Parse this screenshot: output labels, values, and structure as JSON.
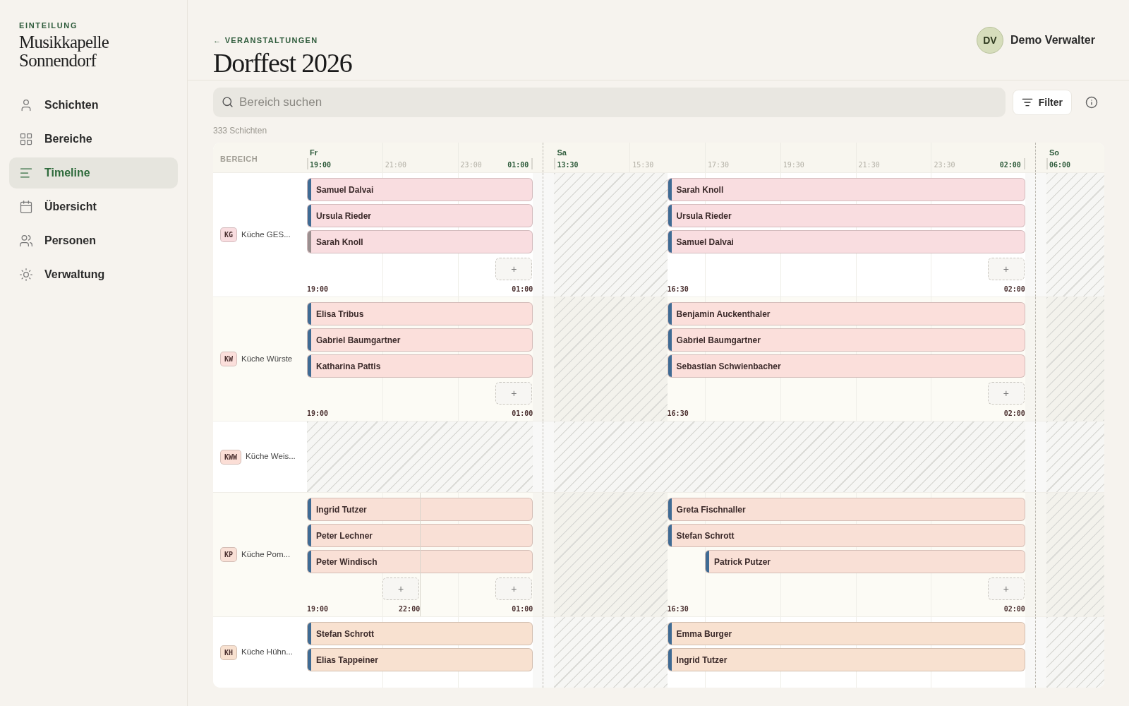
{
  "sidebar": {
    "eyebrow": "EINTEILUNG",
    "org_lines": [
      "Musikkapelle",
      "Sonnendorf"
    ],
    "nav": [
      {
        "label": "Schichten",
        "selected": false
      },
      {
        "label": "Bereiche",
        "selected": false
      },
      {
        "label": "Timeline",
        "selected": true
      },
      {
        "label": "Übersicht",
        "selected": false
      },
      {
        "label": "Personen",
        "selected": false
      },
      {
        "label": "Verwaltung",
        "selected": false
      }
    ]
  },
  "header": {
    "back": "← VERANSTALTUNGEN",
    "title": "Dorffest 2026",
    "user": {
      "initials": "DV",
      "name": "Demo Verwalter"
    }
  },
  "toolbar": {
    "search": {
      "placeholder": "Bereich suchen"
    },
    "filter": "Filter"
  },
  "count": "333 Schichten",
  "timeline": {
    "area_heading": "BEREICH",
    "days": [
      {
        "label": "Fr",
        "ticks": [
          "19:00",
          "21:00",
          "23:00",
          "01:00"
        ]
      },
      {
        "label": "Sa",
        "ticks": [
          "13:30",
          "15:30",
          "17:30",
          "19:30",
          "21:30",
          "23:30",
          "02:00"
        ]
      },
      {
        "label": "So",
        "ticks": [
          "06:00"
        ]
      }
    ],
    "rows": [
      {
        "code": "KG",
        "name": "Küche GES...",
        "color": "#f9dde0",
        "cells": [
          {
            "bounds": [
              "19:00",
              "01:00"
            ],
            "adds": [
              "+"
            ],
            "shifts": [
              {
                "name": "Samuel Dalvai",
                "color": "#3f6b94"
              },
              {
                "name": "Ursula Rieder",
                "color": "#3f6b94"
              },
              {
                "name": "Sarah Knoll",
                "color": "#9a8f8f"
              }
            ]
          },
          {
            "bounds": [
              "16:30",
              "02:00"
            ],
            "adds": [
              "+"
            ],
            "shifts": [
              {
                "name": "Sarah Knoll",
                "color": "#3f6b94"
              },
              {
                "name": "Ursula Rieder",
                "color": "#3f6b94"
              },
              {
                "name": "Samuel Dalvai",
                "color": "#3f6b94"
              }
            ]
          },
          {}
        ]
      },
      {
        "code": "KW",
        "name": "Küche Würste",
        "color": "#fbdfdb",
        "cells": [
          {
            "bounds": [
              "19:00",
              "01:00"
            ],
            "adds": [
              "+"
            ],
            "shifts": [
              {
                "name": "Elisa Tribus",
                "color": "#3f6b94"
              },
              {
                "name": "Gabriel Baumgartner",
                "color": "#3f6b94"
              },
              {
                "name": "Katharina Pattis",
                "color": "#3f6b94"
              }
            ]
          },
          {
            "bounds": [
              "16:30",
              "02:00"
            ],
            "adds": [
              "+"
            ],
            "shifts": [
              {
                "name": "Benjamin Auckenthaler",
                "color": "#3f6b94"
              },
              {
                "name": "Gabriel Baumgartner",
                "color": "#3f6b94"
              },
              {
                "name": "Sebastian Schwienbacher",
                "color": "#3f6b94"
              }
            ]
          },
          {}
        ]
      },
      {
        "code": "KWW",
        "name": "Küche Weis...",
        "color": "#fbded6",
        "cells": [
          {},
          {},
          {}
        ]
      },
      {
        "code": "KP",
        "name": "Küche Pom...",
        "color": "#f9e0d6",
        "cells": [
          {
            "bounds": [
              "19:00",
              "22:00",
              "01:00"
            ],
            "adds": [
              "+",
              "+"
            ],
            "shifts": [
              {
                "name": "Ingrid Tutzer",
                "color": "#3f6b94"
              },
              {
                "name": "Peter Lechner",
                "color": "#3f6b94"
              },
              {
                "name": "Peter Windisch",
                "color": "#3f6b94"
              }
            ]
          },
          {
            "bounds": [
              "16:30",
              "02:00"
            ],
            "adds": [
              "+"
            ],
            "shifts": [
              {
                "name": "Greta Fischnaller",
                "color": "#3f6b94",
                "late": false
              },
              {
                "name": "Stefan Schrott",
                "color": "#3f6b94",
                "late": false
              },
              {
                "name": "Patrick Putzer",
                "color": "#3f6b94",
                "late": true
              }
            ]
          },
          {}
        ]
      },
      {
        "code": "KH",
        "name": "Küche Hühn...",
        "color": "#f8e1d0",
        "cells": [
          {
            "shifts": [
              {
                "name": "Stefan Schrott",
                "color": "#3f6b94"
              },
              {
                "name": "Elias Tappeiner",
                "color": "#3f6b94"
              }
            ]
          },
          {
            "shifts": [
              {
                "name": "Emma Burger",
                "color": "#3f6b94"
              },
              {
                "name": "Ingrid Tutzer",
                "color": "#3f6b94"
              }
            ]
          },
          {}
        ]
      }
    ]
  }
}
